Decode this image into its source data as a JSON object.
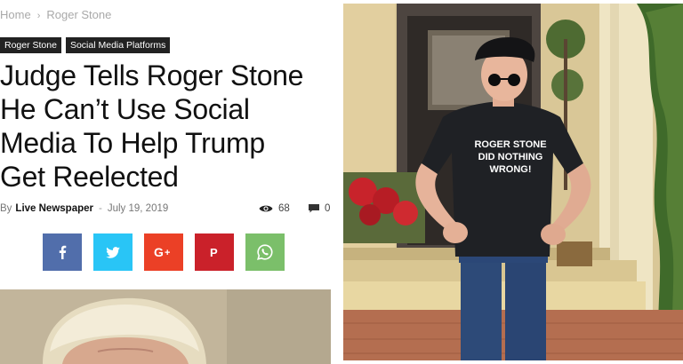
{
  "breadcrumb": {
    "items": [
      "Home",
      "Roger Stone"
    ],
    "separator": "›"
  },
  "categories": [
    "Roger Stone",
    "Social Media Platforms"
  ],
  "article": {
    "headline_lines": [
      "Judge Tells Roger Stone",
      "He Can’t Use Social",
      "Media To Help Trump",
      "Get Reelected"
    ],
    "by_prefix": "By",
    "author": "Live Newspaper",
    "date_separator": "-",
    "date": "July 19, 2019",
    "views": "68",
    "comments": "0"
  },
  "share": {
    "buttons": [
      {
        "name": "facebook",
        "glyph": "f",
        "color": "#516eab"
      },
      {
        "name": "twitter",
        "glyph": "twitter",
        "color": "#29c5f6"
      },
      {
        "name": "google-plus",
        "glyph": "G+",
        "color": "#eb4026"
      },
      {
        "name": "pinterest",
        "glyph": "P",
        "color": "#ca212a"
      },
      {
        "name": "whatsapp",
        "glyph": "whatsapp",
        "color": "#7bbf6a"
      }
    ]
  },
  "photo": {
    "shirt_lines": [
      "ROGER STONE",
      "DID NOTHING",
      "WRONG!"
    ]
  }
}
